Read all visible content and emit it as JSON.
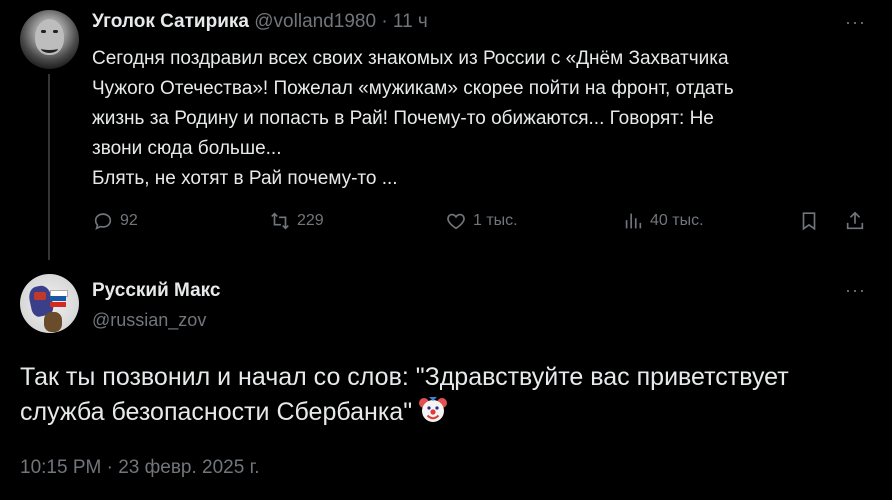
{
  "tweet1": {
    "display_name": "Уголок Сатирика",
    "handle": "@volland1980",
    "separator": "·",
    "time": "11 ч",
    "more": "···",
    "lines": [
      "Сегодня поздравил всех своих знакомых из России с «Днём Захватчика",
      "Чужого Отечества»! Пожелал «мужикам» скорее пойти на фронт, отдать",
      "жизнь за Родину и попасть в Рай! Почему-то обижаются... Говорят: Не",
      "звони сюда больше...",
      "Блять, не хотят в Рай почему-то ..."
    ],
    "actions": {
      "replies": "92",
      "retweets": "229",
      "likes": "1 тыс.",
      "views": "40 тыс."
    },
    "icons": [
      "reply-icon",
      "retweet-icon",
      "like-icon",
      "views-icon",
      "bookmark-icon",
      "share-icon"
    ]
  },
  "tweet2": {
    "display_name": "Русский Макс",
    "handle": "@russian_zov",
    "more": "···",
    "text": "Так ты позвонил и начал со слов: \"Здравствуйте вас приветствует служба безопасности Сбербанка\"",
    "emoji": "clown-face-icon",
    "timestamp": "10:15 PM · 23 февр. 2025 г."
  },
  "colors": {
    "background": "#000000",
    "text": "#e7e9ea",
    "muted": "#71767b",
    "thread_line": "#333639"
  }
}
